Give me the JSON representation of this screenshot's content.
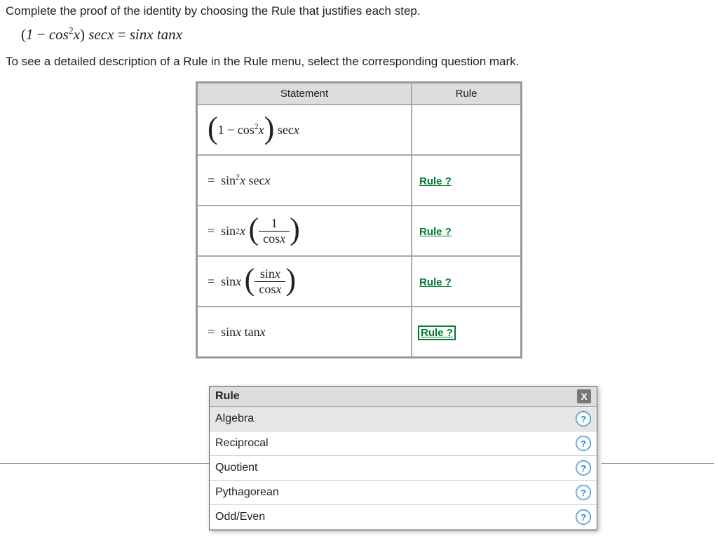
{
  "instruction1": "Complete the proof of the identity by choosing the Rule that justifies each step.",
  "identity_plain": "(1 − cos²x) secx = sinx tanx",
  "instruction2": "To see a detailed description of a Rule in the Rule menu, select the corresponding question mark.",
  "table": {
    "header_statement": "Statement",
    "header_rule": "Rule",
    "rows": [
      {
        "statement_plain": "(1 − cos²x) secx",
        "rule_link": "",
        "active": false
      },
      {
        "statement_plain": "= sin²x secx",
        "rule_link": "Rule ?",
        "active": false
      },
      {
        "statement_plain": "= sin²x (1 / cosx)",
        "rule_link": "Rule ?",
        "active": false
      },
      {
        "statement_plain": "= sinx (sinx / cosx)",
        "rule_link": "Rule ?",
        "active": false
      },
      {
        "statement_plain": "= sinx tanx",
        "rule_link": "Rule ?",
        "active": true
      }
    ]
  },
  "rule_menu": {
    "title": "Rule",
    "close": "X",
    "items": [
      {
        "label": "Algebra",
        "highlighted": true
      },
      {
        "label": "Reciprocal",
        "highlighted": false
      },
      {
        "label": "Quotient",
        "highlighted": false
      },
      {
        "label": "Pythagorean",
        "highlighted": false
      },
      {
        "label": "Odd/Even",
        "highlighted": false
      }
    ]
  }
}
